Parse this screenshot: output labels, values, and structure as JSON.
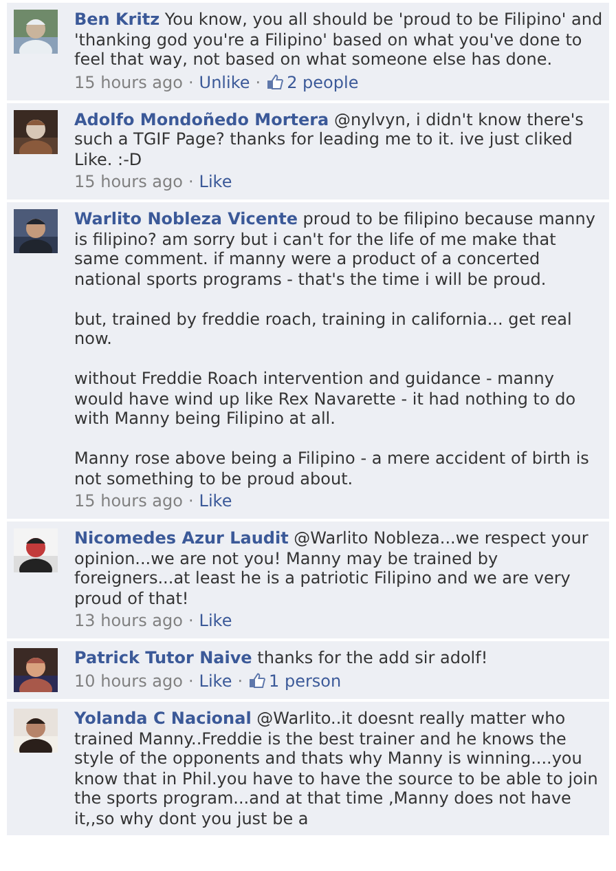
{
  "comments": [
    {
      "author": "Ben Kritz",
      "paragraphs": [
        "You know, you all should be 'proud to be Filipino' and 'thanking god you're a Filipino' based on what you've done to feel that way, not based on what someone else has done."
      ],
      "avatar": {
        "kind": "picture"
      },
      "meta": [
        {
          "kind": "time",
          "text": "15 hours ago"
        },
        {
          "kind": "sep",
          "text": "·"
        },
        {
          "kind": "action",
          "text": "Unlike"
        },
        {
          "kind": "sep",
          "text": "·"
        },
        {
          "kind": "likes",
          "text": "2 people"
        }
      ]
    },
    {
      "author": "Adolfo Mondoñedo Mortera",
      "paragraphs": [
        "@nylvyn, i didn't know there's such a TGIF Page? thanks for leading me to it. ive just cliked Like. :-D"
      ],
      "avatar": {
        "kind": "picture"
      },
      "meta": [
        {
          "kind": "time",
          "text": "15 hours ago"
        },
        {
          "kind": "sep",
          "text": "·"
        },
        {
          "kind": "action",
          "text": "Like"
        }
      ]
    },
    {
      "author": "Warlito Nobleza Vicente",
      "paragraphs": [
        "proud to be filipino because manny is filipino? am sorry but i can't for the life of me make that same comment. if manny were a product of a concerted national sports programs - that's the time i will be proud.",
        "but, trained by freddie roach, training in california... get real now.",
        "without Freddie Roach intervention and guidance - manny would have wind up like Rex Navarette - it had nothing to do with Manny being Filipino at all.",
        "Manny rose above being a Filipino - a mere accident of birth is not something to be proud about."
      ],
      "avatar": {
        "kind": "picture"
      },
      "meta": [
        {
          "kind": "time",
          "text": "15 hours ago"
        },
        {
          "kind": "sep",
          "text": "·"
        },
        {
          "kind": "action",
          "text": "Like"
        }
      ]
    },
    {
      "author": "Nicomedes Azur Laudit",
      "paragraphs": [
        "@Warlito Nobleza...we respect your opinion...we are not you! Manny may be trained by foreigners...at least he is a patriotic Filipino and we are very proud of that!"
      ],
      "avatar": {
        "kind": "picture"
      },
      "meta": [
        {
          "kind": "time",
          "text": "13 hours ago"
        },
        {
          "kind": "sep",
          "text": "·"
        },
        {
          "kind": "action",
          "text": "Like"
        }
      ]
    },
    {
      "author": "Patrick Tutor Naive",
      "paragraphs": [
        "thanks for the add sir adolf!"
      ],
      "avatar": {
        "kind": "picture"
      },
      "meta": [
        {
          "kind": "time",
          "text": "10 hours ago"
        },
        {
          "kind": "sep",
          "text": "·"
        },
        {
          "kind": "action",
          "text": "Like"
        },
        {
          "kind": "sep",
          "text": "·"
        },
        {
          "kind": "likes",
          "text": "1 person"
        }
      ]
    },
    {
      "author": "Yolanda C Nacional",
      "paragraphs": [
        "@Warlito..it doesnt really matter who trained Manny..Freddie is the best trainer and he knows the style of the opponents and thats why Manny is winning....you know that in Phil.you have to have the source to be able to join the sports program...and at that time ,Manny does not have it,,so why dont you just be a"
      ],
      "avatar": {
        "kind": "picture"
      }
    }
  ]
}
